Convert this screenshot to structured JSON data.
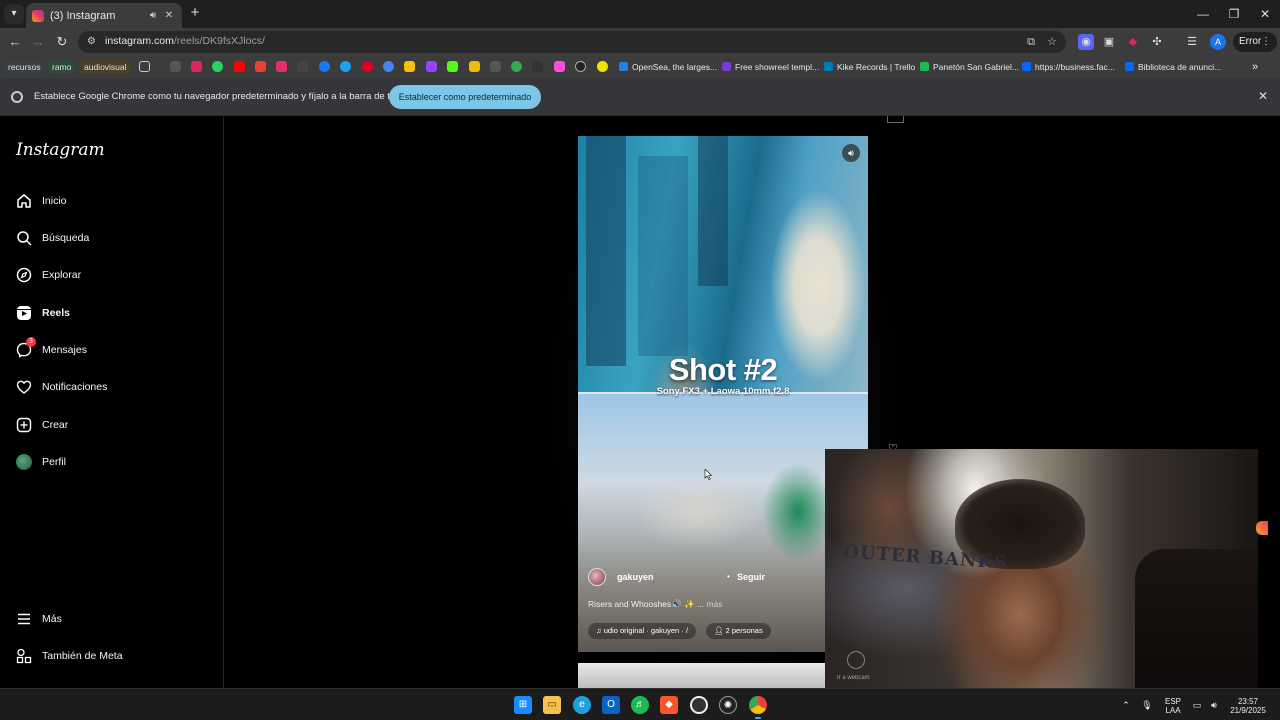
{
  "browser": {
    "tab": {
      "title": "(3) Instagram"
    },
    "window_controls": [
      "—",
      "❐",
      "✕"
    ],
    "address": {
      "domain": "instagram.com",
      "path": "/reels/DK9fsXJlocs/"
    },
    "error_chip": "Error",
    "profile_initial": "A"
  },
  "bookmarks": {
    "folders": [
      "recursos",
      "ramo",
      "audiovisual"
    ],
    "named": [
      {
        "label": "OpenSea, the larges...",
        "color": "#2081e2"
      },
      {
        "label": "Free showreel templ...",
        "color": "#7a3ad6"
      },
      {
        "label": "Kike Records | Trello",
        "color": "#0079bf"
      },
      {
        "label": "Panetón San Gabriel...",
        "color": "#1db954"
      },
      {
        "label": "https://business.fac...",
        "color": "#0866ff"
      },
      {
        "label": "Biblioteca de anunci...",
        "color": "#0866ff"
      }
    ],
    "overflow": "»"
  },
  "infobar": {
    "message": "Establece Google Chrome como tu navegador predeterminado y fíjalo a la barra de tareas",
    "cta": "Establecer como predeterminado"
  },
  "instagram": {
    "logo": "Instagram",
    "nav": [
      {
        "label": "Inicio"
      },
      {
        "label": "Búsqueda"
      },
      {
        "label": "Explorar"
      },
      {
        "label": "Reels"
      },
      {
        "label": "Mensajes",
        "badge": "3"
      },
      {
        "label": "Notificaciones"
      },
      {
        "label": "Crear"
      },
      {
        "label": "Perfil"
      }
    ],
    "bottom_nav": [
      {
        "label": "Más"
      },
      {
        "label": "También de Meta"
      }
    ]
  },
  "reel": {
    "title": "Shot #2",
    "subtitle": "Sony FX3 + Laowa 10mm f2.8",
    "author": "gakuyen",
    "follow_dot": "•",
    "follow": "Seguir",
    "caption": "Risers and Whooshes🔊 ✨ ...",
    "caption_more": "más",
    "audio": "udio original · gakuyen · /",
    "people": "2 personas"
  },
  "webcam": {
    "shirt_text": "OUTER BANKS",
    "label": "Ir a webcam"
  },
  "taskbar": {
    "lang_top": "ESP",
    "lang_bottom": "LAA",
    "time": "23:57",
    "date": "21/9/2025"
  },
  "colors": {
    "ig_accent": "#ff3040",
    "chrome_cta": "#7cc7e8"
  }
}
